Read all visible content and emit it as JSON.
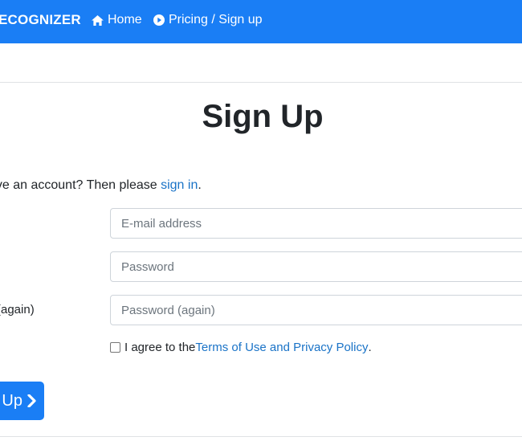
{
  "navbar": {
    "brand": "ECOGNIZER",
    "home_label": "Home",
    "pricing_label": "Pricing / Sign up",
    "home_icon": "home-icon",
    "pricing_icon": "play-circle-icon",
    "bg_color": "#1a7ef5"
  },
  "page": {
    "title": "Sign Up"
  },
  "signin_prompt": {
    "prefix": "ave an account? Then please ",
    "link": "sign in",
    "suffix": "."
  },
  "form": {
    "email_placeholder": "E-mail address",
    "password_placeholder": "Password",
    "password_again_placeholder": "Password (again)",
    "password_again_label": "(again)",
    "agree_prefix": "I agree to the ",
    "agree_link": "Terms of Use and Privacy Policy",
    "agree_suffix": ".",
    "agree_checked": false,
    "submit_label": "Up",
    "submit_icon": "chevron-right-icon"
  }
}
